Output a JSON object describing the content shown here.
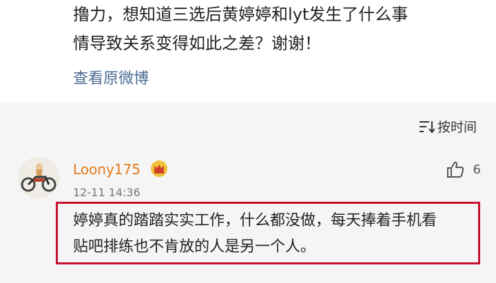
{
  "post": {
    "line1": "撸力，想知道三选后黄婷婷和lyt发生了什么事",
    "line2": "情导致关系变得如此之差？谢谢！",
    "view_original_label": "查看原微博"
  },
  "comments_header": {
    "sort_label": "按时间",
    "sort_icon": "sort-time-icon"
  },
  "comment": {
    "username": "Loony175",
    "badge_icon": "crown-icon",
    "timestamp": "12-11 14:36",
    "like_icon": "thumbs-up-icon",
    "like_count": "6",
    "text_line1": "婷婷真的踏踏实实工作，什么都没做，每天捧着手机看",
    "text_line2": "贴吧排练也不肯放的人是另一个人。",
    "highlight_color": "#c8102e"
  },
  "colors": {
    "username": "#e07b1a",
    "link": "#4a6b93",
    "background_comments": "#f5f5f5"
  }
}
